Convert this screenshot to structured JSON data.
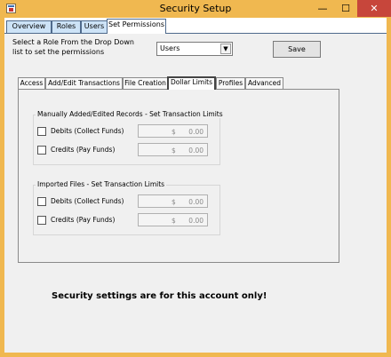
{
  "window": {
    "title": "Security Setup",
    "minimize": "—",
    "maximize": "☐",
    "close": "✕"
  },
  "main_tabs": [
    {
      "label": "Overview"
    },
    {
      "label": "Roles"
    },
    {
      "label": "Users"
    },
    {
      "label": "Set Permissions"
    }
  ],
  "permissions": {
    "instructions_line1": "Select a Role From the Drop Down",
    "instructions_line2": "list to set the permissions",
    "role_select": {
      "value": "Users",
      "arrow": "▼"
    },
    "save_label": "Save"
  },
  "sub_tabs": [
    {
      "label": "Access"
    },
    {
      "label": "Add/Edit Transactions"
    },
    {
      "label": "File Creation"
    },
    {
      "label": "Dollar Limits"
    },
    {
      "label": "Profiles"
    },
    {
      "label": "Advanced"
    }
  ],
  "active_sub_tab": "Dollar Limits",
  "groups": {
    "manual": {
      "title": "Manually Added/Edited Records - Set Transaction Limits",
      "debits": {
        "label": "Debits (Collect Funds)",
        "checked": false,
        "currency": "$",
        "amount": "0.00"
      },
      "credits": {
        "label": "Credits (Pay Funds)",
        "checked": false,
        "currency": "$",
        "amount": "0.00"
      }
    },
    "imported": {
      "title": "Imported Files - Set Transaction Limits",
      "debits": {
        "label": "Debits (Collect Funds)",
        "checked": false,
        "currency": "$",
        "amount": "0.00"
      },
      "credits": {
        "label": "Credits (Pay Funds)",
        "checked": false,
        "currency": "$",
        "amount": "0.00"
      }
    }
  },
  "account_message": "Security settings are for this account only!",
  "colors": {
    "title_bar": "#f0b850",
    "close_button": "#c7463b",
    "tab_inactive": "#cde3f7",
    "panel_background": "#f0f0f0"
  }
}
